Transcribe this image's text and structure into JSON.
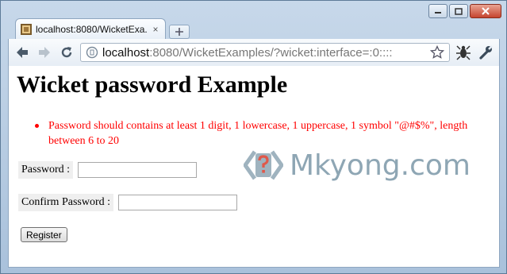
{
  "browser": {
    "tab_title": "localhost:8080/WicketExa...",
    "tab_close": "×",
    "url_host": "localhost",
    "url_rest": ":8080/WicketExamples/?wicket:interface=:0::::"
  },
  "page": {
    "title": "Wicket password Example",
    "feedback_messages": [
      "Password should contains at least 1 digit, 1 lowercase, 1 uppercase, 1 symbol \"@#$%\", length between 6 to 20"
    ],
    "password_label": "Password",
    "confirm_label": "Confirm Password",
    "label_sep": ":",
    "password_value": "",
    "confirm_value": "",
    "register_button": "Register"
  },
  "watermark": {
    "text": "Mkyong.com"
  },
  "colors": {
    "error": "#ff0000",
    "watermark": "#8ea6b4"
  },
  "icons": {
    "back": "back-arrow-icon",
    "forward": "forward-arrow-icon",
    "reload": "reload-icon",
    "page": "page-icon",
    "star": "star-icon",
    "extension": "extension-icon",
    "wrench": "wrench-icon"
  }
}
